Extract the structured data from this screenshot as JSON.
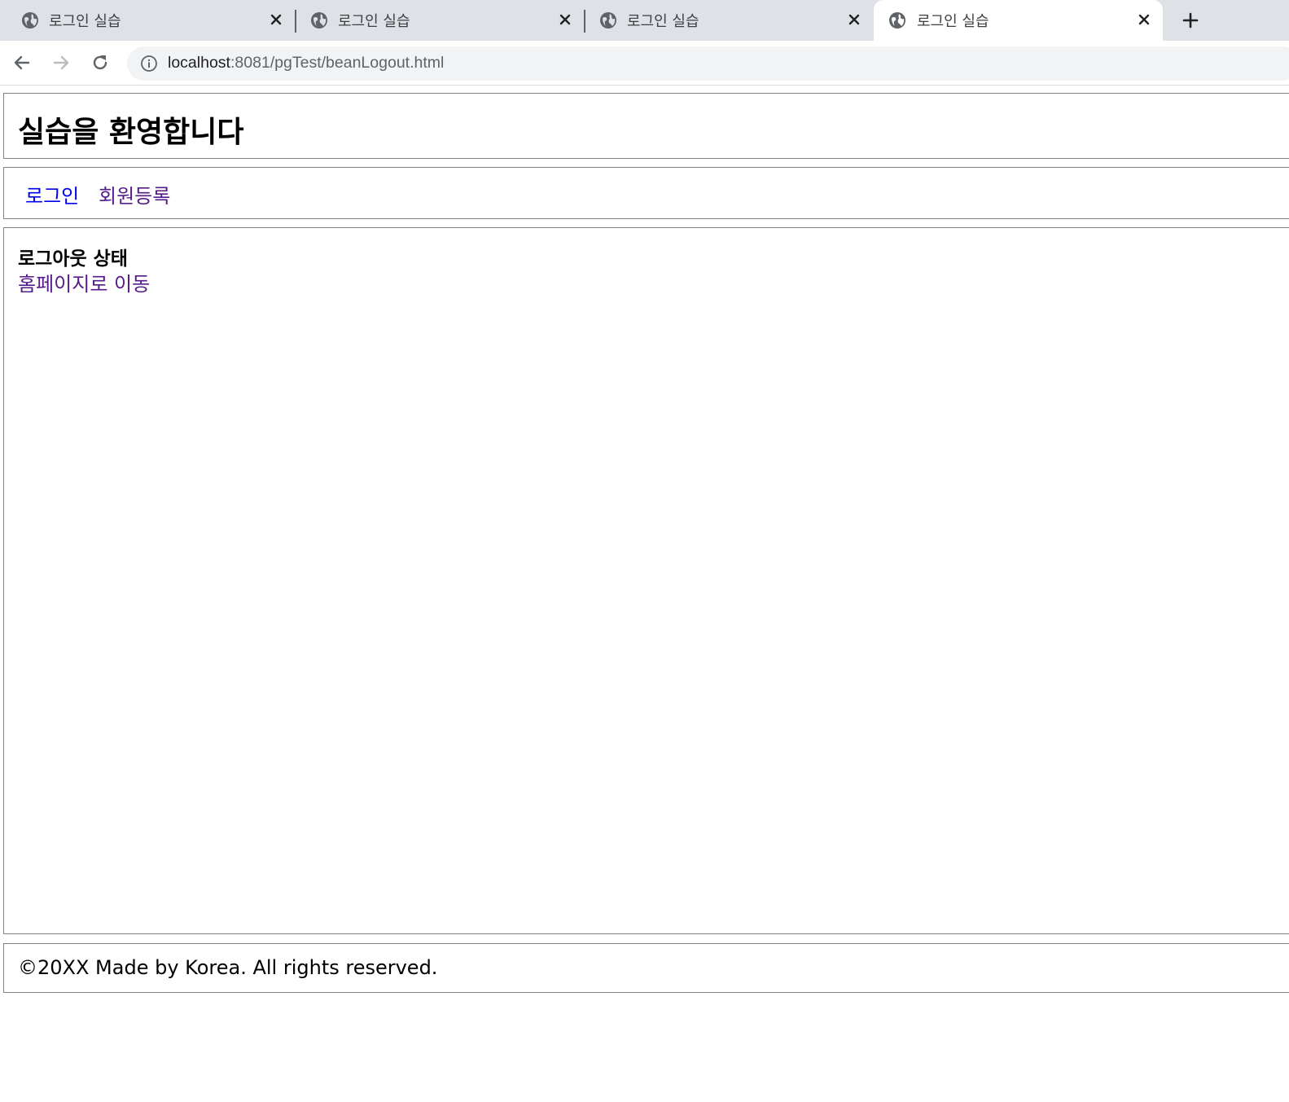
{
  "browser": {
    "tabs": [
      {
        "title": "로그인 실습",
        "active": false
      },
      {
        "title": "로그인 실습",
        "active": false
      },
      {
        "title": "로그인 실습",
        "active": false
      },
      {
        "title": "로그인 실습",
        "active": true
      }
    ],
    "url_host": "localhost",
    "url_path": ":8081/pgTest/beanLogout.html",
    "icons": {
      "tab_favicon": "globe-icon",
      "tab_close": "close-icon",
      "new_tab": "plus-icon",
      "back": "arrow-left-icon",
      "forward": "arrow-right-icon",
      "reload": "reload-icon",
      "site_info": "info-icon"
    }
  },
  "page": {
    "header_title": "실습을 환영합니다",
    "nav": {
      "login": "로그인",
      "register": "회원등록"
    },
    "content": {
      "status": "로그아웃 상태",
      "home_link": "홈페이지로 이동"
    },
    "footer": "©20XX Made by Korea. All rights reserved."
  },
  "colors": {
    "tabstrip_bg": "#dee1e6",
    "omnibox_bg": "#f1f3f4",
    "link_unvisited": "#0000ee",
    "link_visited": "#551a8b",
    "box_border": "#808080"
  }
}
